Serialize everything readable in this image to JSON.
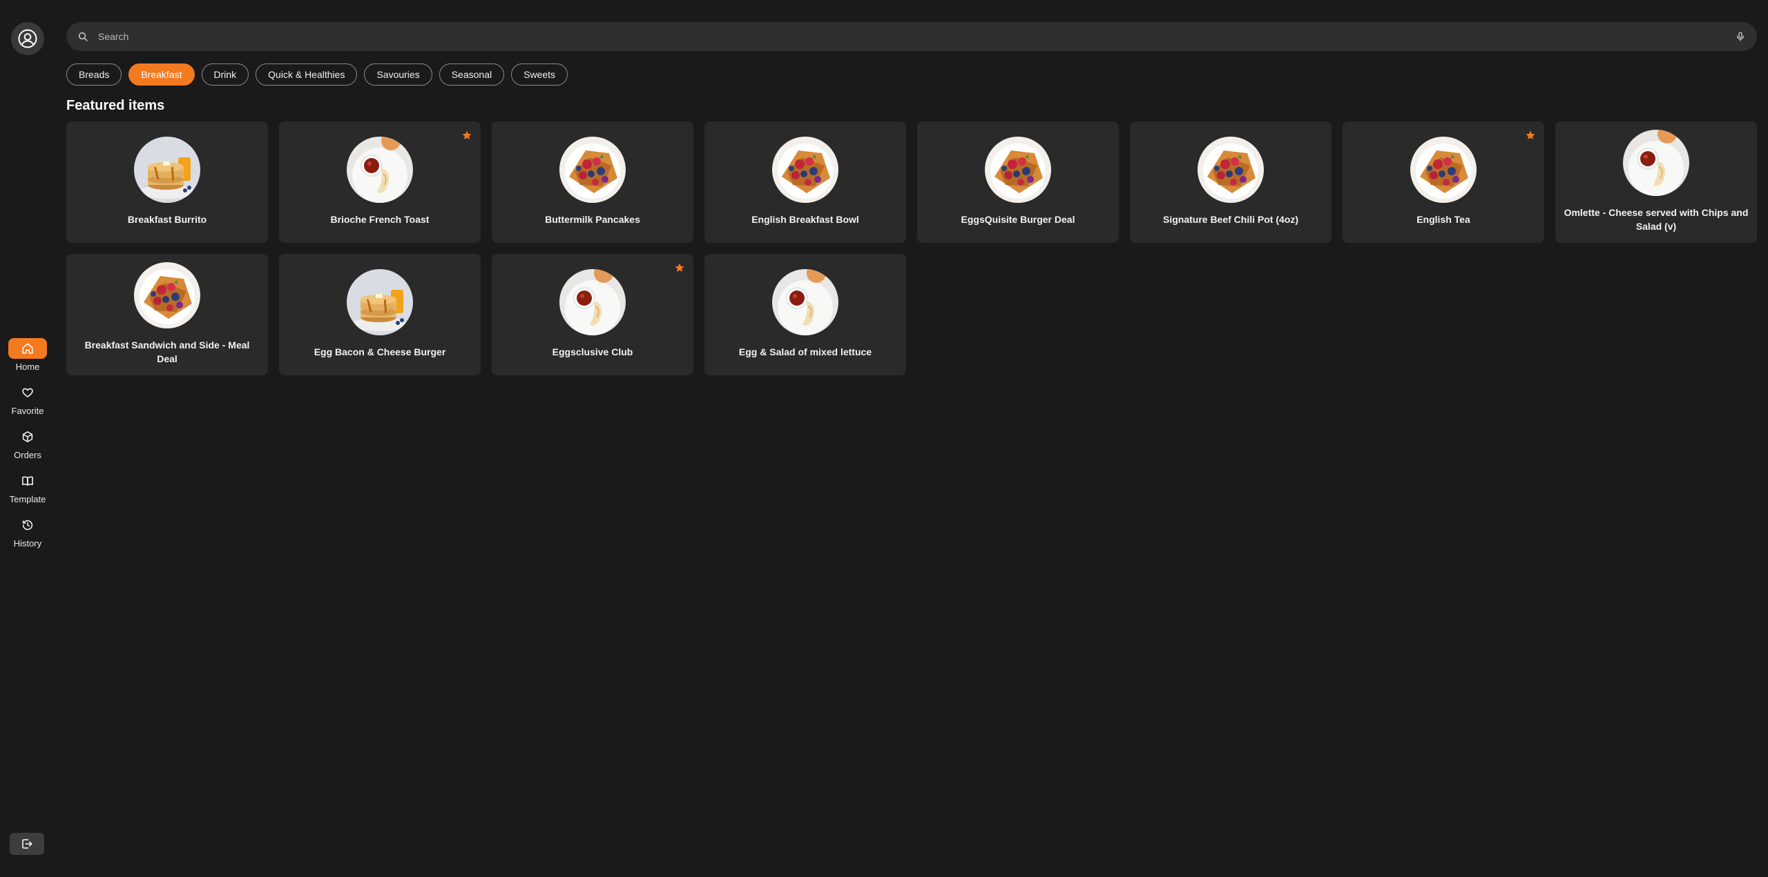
{
  "search": {
    "placeholder": "Search"
  },
  "categories": [
    {
      "label": "Breads",
      "active": false
    },
    {
      "label": "Breakfast",
      "active": true
    },
    {
      "label": "Drink",
      "active": false
    },
    {
      "label": "Quick & Healthies",
      "active": false
    },
    {
      "label": "Savouries",
      "active": false
    },
    {
      "label": "Seasonal",
      "active": false
    },
    {
      "label": "Sweets",
      "active": false
    }
  ],
  "section_title": "Featured items",
  "items": [
    {
      "name": "Breakfast Burrito",
      "image": "pancakes",
      "starred": false
    },
    {
      "name": "Brioche French Toast",
      "image": "omelette",
      "starred": true
    },
    {
      "name": "Buttermilk Pancakes",
      "image": "waffle",
      "starred": false
    },
    {
      "name": "English Breakfast Bowl",
      "image": "waffle",
      "starred": false
    },
    {
      "name": "EggsQuisite Burger Deal",
      "image": "waffle",
      "starred": false
    },
    {
      "name": "Signature Beef Chili Pot (4oz)",
      "image": "waffle",
      "starred": false
    },
    {
      "name": "English Tea",
      "image": "waffle",
      "starred": true
    },
    {
      "name": "Omlette - Cheese served with Chips and Salad (v)",
      "image": "omelette",
      "starred": false
    },
    {
      "name": "Breakfast Sandwich and Side - Meal Deal",
      "image": "waffle",
      "starred": false
    },
    {
      "name": "Egg Bacon & Cheese Burger",
      "image": "pancakes",
      "starred": false
    },
    {
      "name": "Eggsclusive Club",
      "image": "omelette",
      "starred": true
    },
    {
      "name": "Egg & Salad of mixed lettuce",
      "image": "omelette",
      "starred": false
    }
  ],
  "nav": [
    {
      "label": "Home",
      "icon": "home-icon",
      "active": true
    },
    {
      "label": "Favorite",
      "icon": "heart-icon",
      "active": false
    },
    {
      "label": "Orders",
      "icon": "box-icon",
      "active": false
    },
    {
      "label": "Template",
      "icon": "book-icon",
      "active": false
    },
    {
      "label": "History",
      "icon": "history-icon",
      "active": false
    }
  ],
  "colors": {
    "accent": "#f47a20",
    "background": "#1a1a1a",
    "card": "#2a2a2a"
  }
}
